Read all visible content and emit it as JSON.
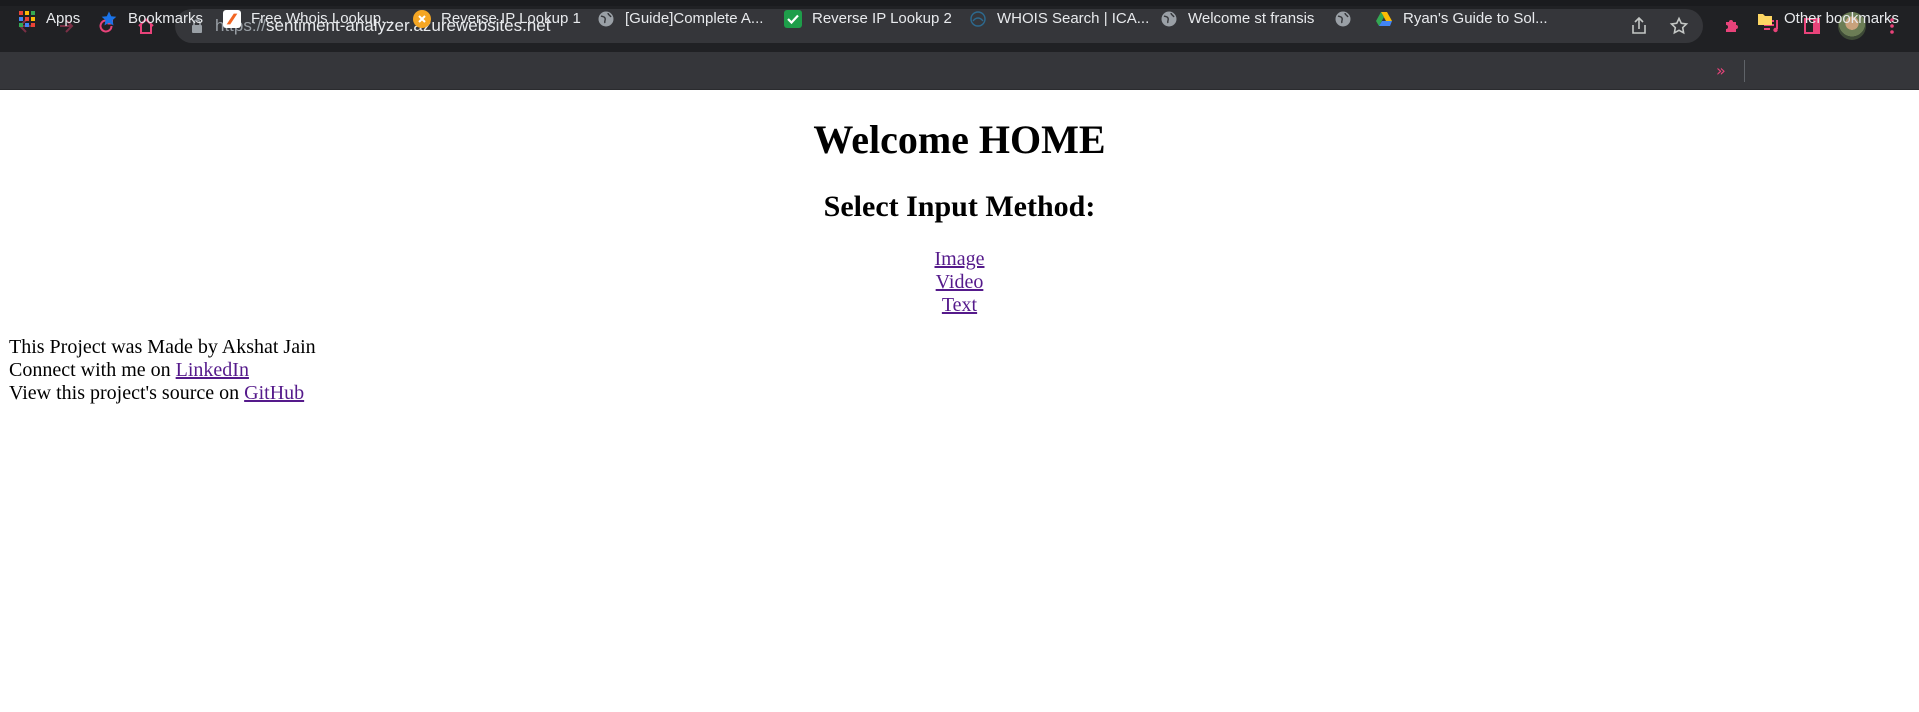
{
  "browser": {
    "url_scheme": "https://",
    "url_host": "sentiment-analyzer.azurewebsites.net",
    "accent_color": "#e8437a"
  },
  "bookmarks_bar": {
    "items": [
      {
        "label": "Apps",
        "icon": "apps-grid-icon"
      },
      {
        "label": "Bookmarks",
        "icon": "star-icon"
      },
      {
        "label": "Free Whois Lookup...",
        "icon": "whois-favicon"
      },
      {
        "label": "Reverse IP Lookup 1",
        "icon": "reverse-ip-favicon"
      },
      {
        "label": "[Guide]Complete A...",
        "icon": "globe-icon"
      },
      {
        "label": "Reverse IP Lookup 2",
        "icon": "check-favicon"
      },
      {
        "label": "WHOIS Search | ICA...",
        "icon": "icann-favicon"
      },
      {
        "label": "Welcome st fransis",
        "icon": "globe-icon"
      },
      {
        "label": "",
        "icon": "globe-icon"
      },
      {
        "label": "Ryan's Guide to Sol...",
        "icon": "google-drive-icon"
      }
    ],
    "overflow": "»",
    "other_bookmarks": "Other bookmarks"
  },
  "page": {
    "title": "Welcome HOME",
    "subtitle": "Select Input Method:",
    "links": [
      "Image",
      "Video",
      "Text"
    ],
    "footer": {
      "line1": "This Project was Made by Akshat Jain",
      "line2_prefix": "Connect with me on ",
      "line2_link": "LinkedIn",
      "line3_prefix": "View this project's source on ",
      "line3_link": "GitHub"
    }
  }
}
